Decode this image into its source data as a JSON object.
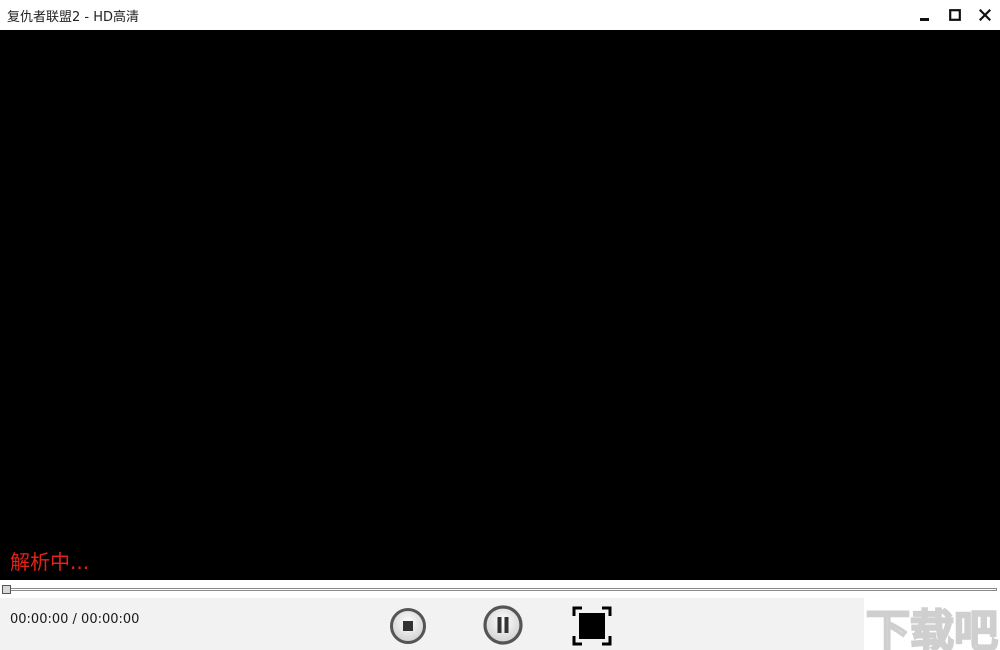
{
  "window": {
    "title": "复仇者联盟2 - HD高清",
    "controls": {
      "minimize_icon": "minimize-icon",
      "maximize_icon": "maximize-icon",
      "close_icon": "close-icon"
    }
  },
  "video": {
    "status_text": "解析中...",
    "status_color": "#e62117",
    "background": "#000000"
  },
  "playback": {
    "progress_fraction": 0,
    "time_current": "00:00:00",
    "time_separator": " / ",
    "time_total": "00:00:00"
  },
  "controls": {
    "stop_icon": "stop-icon",
    "pause_icon": "pause-icon",
    "fullscreen_icon": "fullscreen-icon"
  },
  "watermark": {
    "text": "下载吧",
    "icon": "xiazaiba-logo-watermark"
  }
}
